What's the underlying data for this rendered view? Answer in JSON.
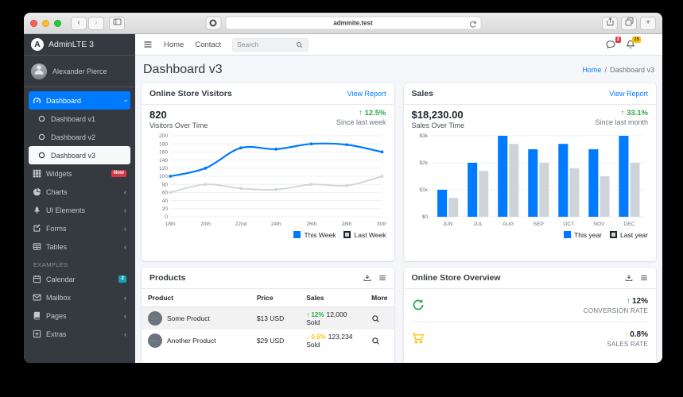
{
  "browser": {
    "url": "adminite.test"
  },
  "navbar": {
    "links": [
      "Home",
      "Contact"
    ],
    "search_placeholder": "Search",
    "messages_badge": "3",
    "notifications_badge": "15"
  },
  "sidebar": {
    "brand": "AdminLTE 3",
    "brand_initial": "A",
    "user": "Alexander Pierce",
    "items": [
      {
        "label": "Dashboard",
        "icon": "gauge-icon",
        "active": true,
        "chevron": "down"
      },
      {
        "label": "Dashboard v1",
        "icon": "circle-icon",
        "sub": true
      },
      {
        "label": "Dashboard v2",
        "icon": "circle-icon",
        "sub": true
      },
      {
        "label": "Dashboard v3",
        "icon": "circle-icon",
        "sub": true,
        "active_sub": true
      },
      {
        "label": "Widgets",
        "icon": "grid-icon",
        "badge": "New",
        "badge_color": "#dc3545"
      },
      {
        "label": "Charts",
        "icon": "pie-icon",
        "chevron": "left"
      },
      {
        "label": "UI Elements",
        "icon": "tree-icon",
        "chevron": "left"
      },
      {
        "label": "Forms",
        "icon": "pen-icon",
        "chevron": "left"
      },
      {
        "label": "Tables",
        "icon": "table-icon",
        "chevron": "left"
      },
      {
        "header": "EXAMPLES"
      },
      {
        "label": "Calendar",
        "icon": "calendar-icon",
        "badge": "2",
        "badge_color": "#17a2b8"
      },
      {
        "label": "Mailbox",
        "icon": "envelope-icon",
        "chevron": "left"
      },
      {
        "label": "Pages",
        "icon": "book-icon",
        "chevron": "left"
      },
      {
        "label": "Extras",
        "icon": "plus-square-icon",
        "chevron": "left"
      }
    ]
  },
  "page": {
    "title": "Dashboard v3",
    "breadcrumb_home": "Home",
    "breadcrumb_sep": "/",
    "breadcrumb_current": "Dashboard v3"
  },
  "visitors_card": {
    "title": "Online Store Visitors",
    "link": "View Report",
    "value": "820",
    "label": "Visitors Over Time",
    "delta_arrow": "↑",
    "delta": "12.5%",
    "note": "Since last week"
  },
  "sales_card": {
    "title": "Sales",
    "link": "View Report",
    "value": "$18,230.00",
    "label": "Sales Over Time",
    "delta_arrow": "↑",
    "delta": "33.1%",
    "note": "Since last month"
  },
  "products_card": {
    "title": "Products",
    "columns": [
      "Product",
      "Price",
      "Sales",
      "More"
    ],
    "rows": [
      {
        "name": "Some Product",
        "price": "$13 USD",
        "delta": "12%",
        "delta_dir": "up",
        "sold": "12,000 Sold"
      },
      {
        "name": "Another Product",
        "price": "$29 USD",
        "delta": "0.5%",
        "delta_dir": "down",
        "sold": "123,234 Sold"
      }
    ]
  },
  "overview_card": {
    "title": "Online Store Overview",
    "rows": [
      {
        "icon": "redo-icon",
        "icon_color": "green",
        "arrow": "↑",
        "delta": "12%",
        "label": "CONVERSION RATE"
      },
      {
        "icon": "cart-icon",
        "icon_color": "yellow",
        "arrow": "↑",
        "delta": "0.8%",
        "label": "SALES RATE"
      }
    ]
  },
  "chart_data": [
    {
      "type": "line",
      "title": "Visitors Over Time",
      "x": [
        "18th",
        "20th",
        "22nd",
        "24th",
        "26th",
        "28th",
        "30th"
      ],
      "series": [
        {
          "name": "This Week",
          "color": "#007bff",
          "values": [
            100,
            120,
            170,
            167,
            180,
            178,
            160
          ]
        },
        {
          "name": "Last Week",
          "color": "#ced4da",
          "values": [
            60,
            80,
            70,
            67,
            80,
            77,
            100
          ]
        }
      ],
      "ylim": [
        0,
        200
      ],
      "ytick_step": 20,
      "grid": true,
      "legend_position": "bottom-right"
    },
    {
      "type": "bar",
      "title": "Sales Over Time",
      "categories": [
        "JUN",
        "JUL",
        "AUG",
        "SEP",
        "OCT",
        "NOV",
        "DEC"
      ],
      "series": [
        {
          "name": "This year",
          "color": "#007bff",
          "values": [
            1000,
            2000,
            3000,
            2500,
            2700,
            2500,
            3000
          ]
        },
        {
          "name": "Last year",
          "color": "#ced4da",
          "values": [
            700,
            1700,
            2700,
            2000,
            1800,
            1500,
            2000
          ]
        }
      ],
      "ylim": [
        0,
        3000
      ],
      "yticks": [
        0,
        1000,
        2000,
        3000
      ],
      "ytick_labels": [
        "$0",
        "$1k",
        "$2k",
        "$3k"
      ],
      "grid": true,
      "legend_position": "bottom-right"
    }
  ],
  "colors": {
    "accent": "#007bff",
    "success": "#28a745",
    "warning": "#ffc107",
    "danger": "#dc3545",
    "info": "#17a2b8",
    "sidebar": "#343a40",
    "content_bg": "#f4f6f9",
    "legend_dark_border": "#212529"
  },
  "product_image_glyph": "···"
}
